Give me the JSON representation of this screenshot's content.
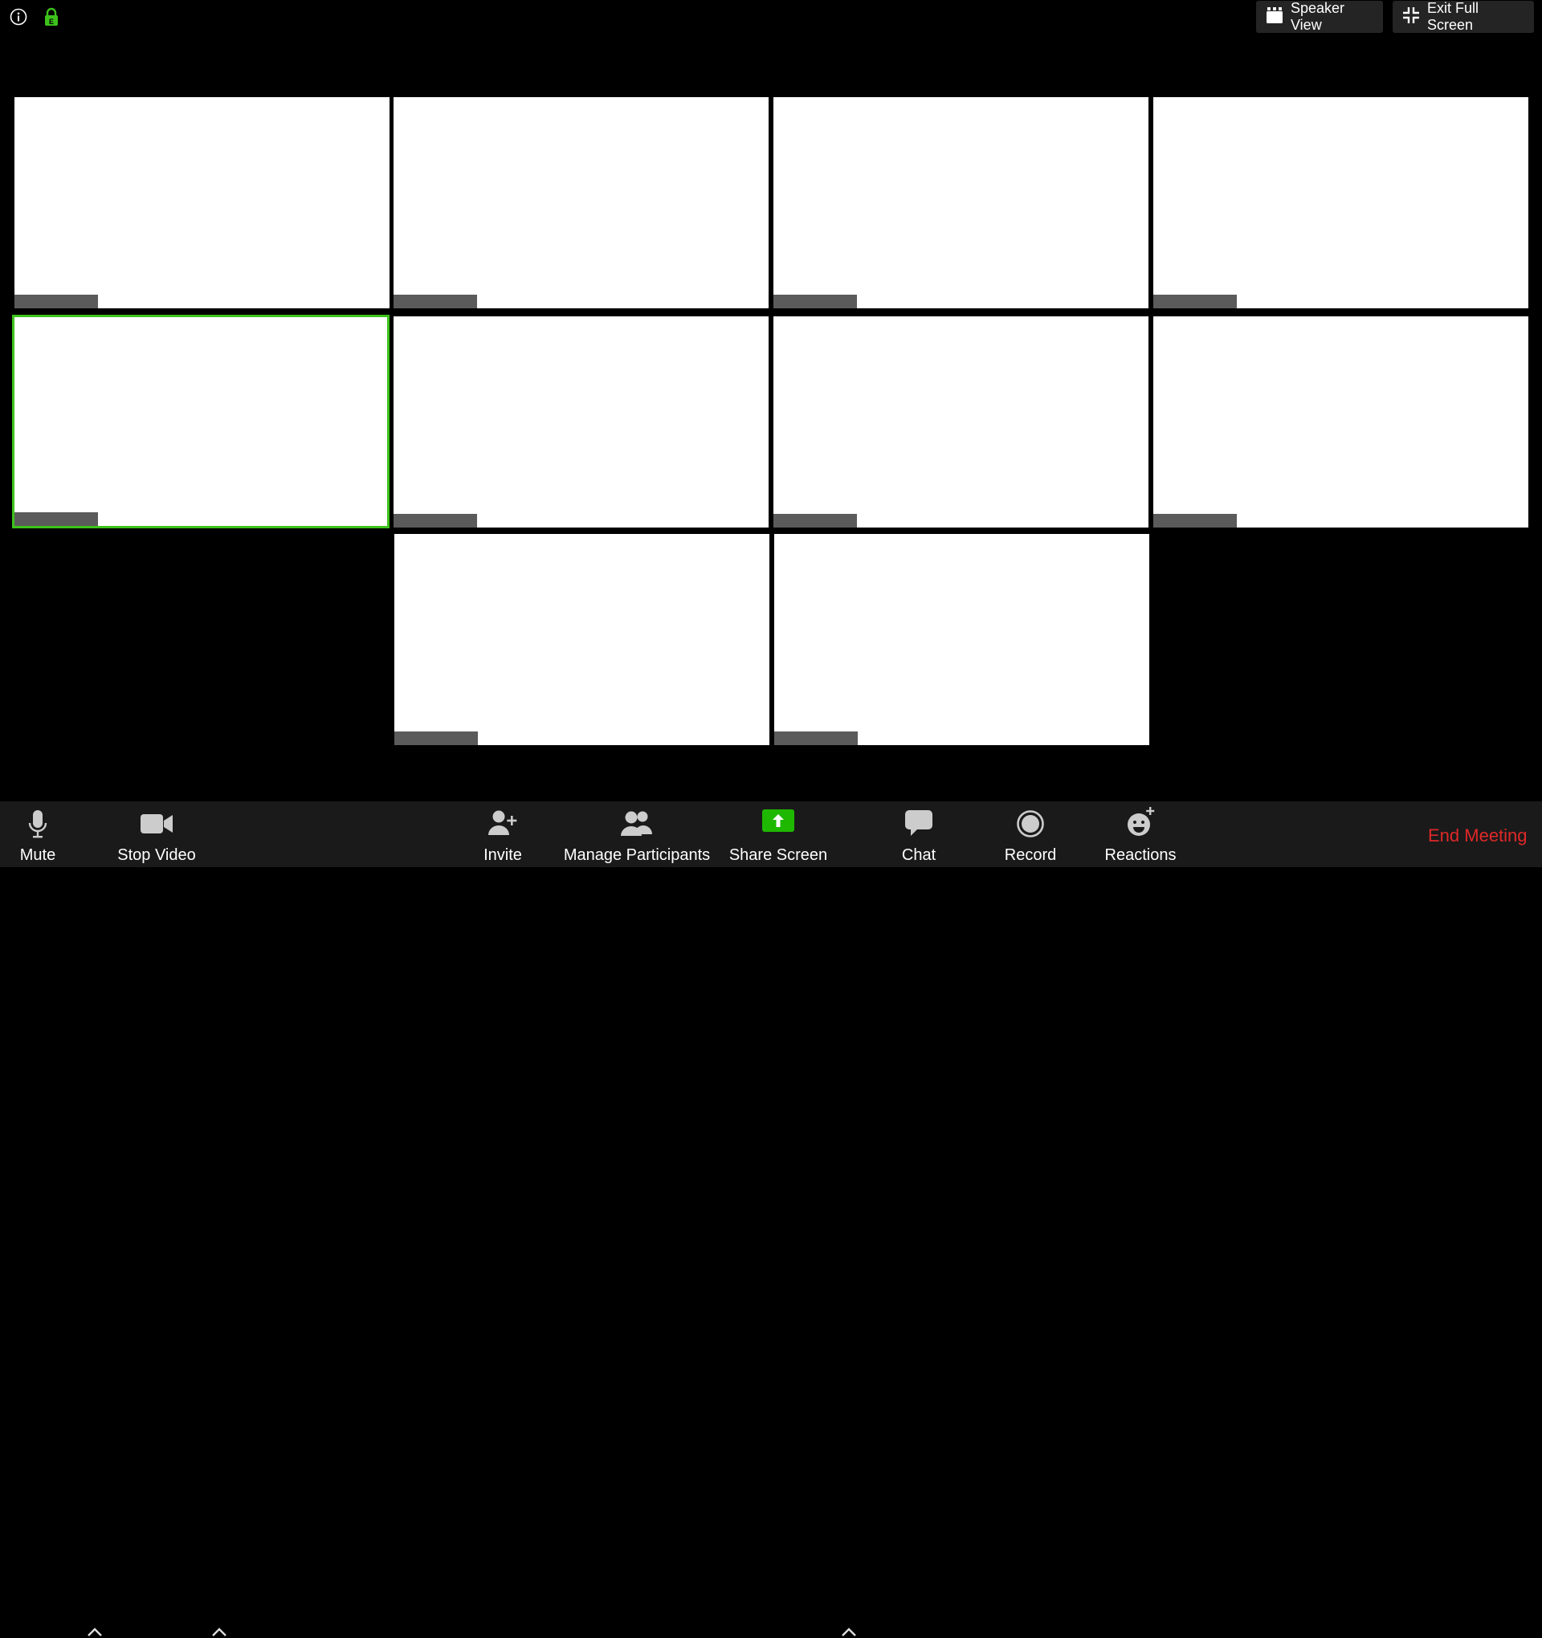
{
  "topbar": {
    "info_icon": "info-icon",
    "lock_icon": "lock-icon",
    "lock_color": "#3dc21b",
    "speaker_view_label": "Speaker View",
    "exit_fullscreen_label": "Exit Full Screen"
  },
  "gallery": {
    "tile_count": 10,
    "active_tile_index": 4,
    "active_border_color": "#3dc21b"
  },
  "toolbar": {
    "mute_label": "Mute",
    "stop_video_label": "Stop Video",
    "invite_label": "Invite",
    "manage_participants_label": "Manage Participants",
    "share_screen_label": "Share Screen",
    "share_screen_color": "#1fb800",
    "chat_label": "Chat",
    "record_label": "Record",
    "reactions_label": "Reactions",
    "end_meeting_label": "End Meeting",
    "end_meeting_color": "#e02828"
  }
}
